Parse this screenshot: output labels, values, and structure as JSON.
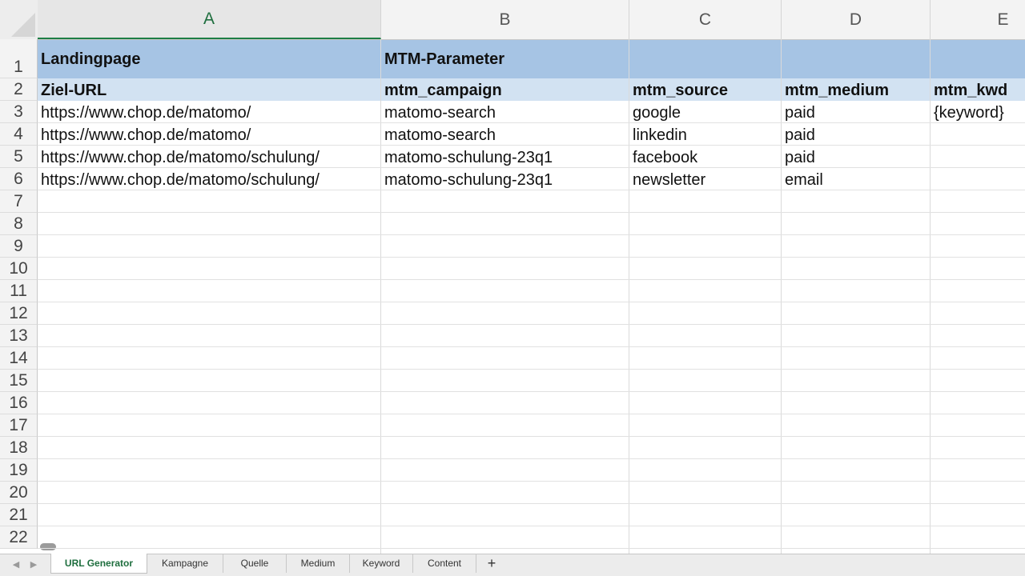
{
  "columns": [
    "A",
    "B",
    "C",
    "D",
    "E"
  ],
  "active_column": "A",
  "rows": [
    "1",
    "2",
    "3",
    "4",
    "5",
    "6",
    "7",
    "8",
    "9",
    "10",
    "11",
    "12",
    "13",
    "14",
    "15",
    "16",
    "17",
    "18",
    "19",
    "20",
    "21",
    "22"
  ],
  "cells": {
    "row1": {
      "A": "Landingpage",
      "B": "MTM-Parameter"
    },
    "row2": {
      "A": "Ziel-URL",
      "B": "mtm_campaign",
      "C": "mtm_source",
      "D": "mtm_medium",
      "E": "mtm_kwd"
    },
    "data": [
      {
        "A": "https://www.chop.de/matomo/",
        "B": "matomo-search",
        "C": "google",
        "D": "paid",
        "E": "{keyword}"
      },
      {
        "A": "https://www.chop.de/matomo/",
        "B": "matomo-search",
        "C": "linkedin",
        "D": "paid",
        "E": ""
      },
      {
        "A": "https://www.chop.de/matomo/schulung/",
        "B": "matomo-schulung-23q1",
        "C": "facebook",
        "D": "paid",
        "E": ""
      },
      {
        "A": "https://www.chop.de/matomo/schulung/",
        "B": "matomo-schulung-23q1",
        "C": "newsletter",
        "D": "email",
        "E": ""
      }
    ]
  },
  "colors": {
    "header_band": "#a6c4e4",
    "subheader_band": "#d2e2f2",
    "accent_green": "#1e7e45"
  },
  "tabs": {
    "active": "URL Generator",
    "items": [
      "URL Generator",
      "Kampagne",
      "Quelle",
      "Medium",
      "Keyword",
      "Content"
    ],
    "add_label": "+"
  },
  "nav": {
    "prev_icon": "chevron-left-icon",
    "next_icon": "chevron-right-icon"
  }
}
